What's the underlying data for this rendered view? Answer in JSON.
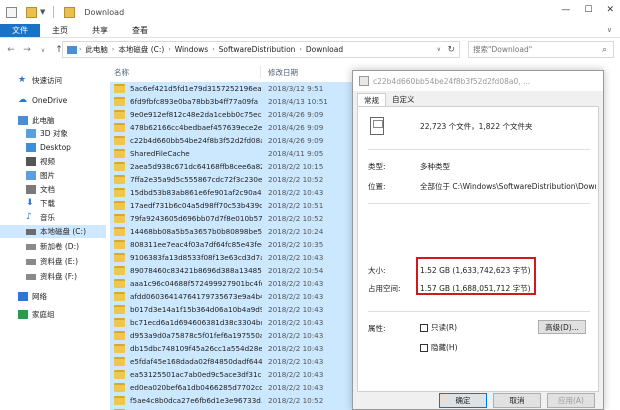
{
  "window": {
    "title": "Download",
    "controls": [
      "—",
      "☐",
      "✕"
    ]
  },
  "ribbon": {
    "tabs": [
      "文件",
      "主页",
      "共享",
      "查看"
    ]
  },
  "address": {
    "crumbs": [
      "此电脑",
      "本地磁盘 (C:)",
      "Windows",
      "SoftwareDistribution",
      "Download"
    ],
    "search_placeholder": "搜索\"Download\""
  },
  "navpane": {
    "items": [
      {
        "label": "快速访问",
        "icon": "star-icon",
        "color": "#2b78d0"
      },
      {
        "label": "OneDrive",
        "icon": "cloud-icon",
        "color": "#2b78d0"
      },
      {
        "label": "此电脑",
        "icon": "computer-icon",
        "color": "#4a8fd6"
      },
      {
        "label": "3D 对象",
        "icon": "cube-icon",
        "color": "#5aa0e0"
      },
      {
        "label": "Desktop",
        "icon": "desktop-icon",
        "color": "#3d8fd9"
      },
      {
        "label": "视频",
        "icon": "video-icon",
        "color": "#555555"
      },
      {
        "label": "图片",
        "icon": "picture-icon",
        "color": "#5aa0e0"
      },
      {
        "label": "文档",
        "icon": "document-icon",
        "color": "#7a7a7a"
      },
      {
        "label": "下载",
        "icon": "download-icon",
        "color": "#2b78d0"
      },
      {
        "label": "音乐",
        "icon": "music-icon",
        "color": "#2b78d0"
      },
      {
        "label": "本地磁盘 (C:)",
        "icon": "drive-icon",
        "color": "#6b6b6b"
      },
      {
        "label": "新加卷 (D:)",
        "icon": "drive-icon",
        "color": "#8a8a8a"
      },
      {
        "label": "资料盘 (E:)",
        "icon": "drive-icon",
        "color": "#8a8a8a"
      },
      {
        "label": "资料盘 (F:)",
        "icon": "drive-icon",
        "color": "#8a8a8a"
      },
      {
        "label": "网络",
        "icon": "network-icon",
        "color": "#2b78d0"
      },
      {
        "label": "家庭组",
        "icon": "homegroup-icon",
        "color": "#2b9a4a"
      }
    ]
  },
  "filelist": {
    "columns": {
      "name": "名称",
      "date": "修改日期"
    },
    "rows": [
      {
        "name": "5ac6ef421d5fd1e79d3157252196ea32",
        "date": "2018/3/12 9:51",
        "selected": true
      },
      {
        "name": "6fd9fbfc893e0ba78bb3b4ff77a09fa",
        "date": "2018/4/13 10:51",
        "selected": true
      },
      {
        "name": "9e0e912ef812c48e2da1cebb0c75ec0d",
        "date": "2018/4/26 9:09",
        "selected": true
      },
      {
        "name": "478b62166cc4bedbaef457639ece2e3b",
        "date": "2018/4/26 9:09",
        "selected": true
      },
      {
        "name": "c22b4d660bb54be24f8b3f52d2fd08a0",
        "date": "2018/4/26 9:09",
        "selected": true
      },
      {
        "name": "SharedFileCache",
        "date": "2018/4/11 9:05",
        "selected": true
      },
      {
        "name": "2aea5d938c671dc64168ffb8cee6a82...",
        "date": "2018/2/2 10:15",
        "selected": true
      },
      {
        "name": "7ffa2e35a9d5c555867cdc72f3c230e0...",
        "date": "2018/2/2 10:52",
        "selected": true
      },
      {
        "name": "15dbd53b83ab861e6fe901af2c90a49...",
        "date": "2018/2/2 10:43",
        "selected": true
      },
      {
        "name": "17aedf731b6c04a5d98ff70c53b439cd...",
        "date": "2018/2/2 10:51",
        "selected": true
      },
      {
        "name": "79fa9243605d696bb07d7f8e010b574...",
        "date": "2018/2/2 10:52",
        "selected": true
      },
      {
        "name": "14468bb08a5b5a3657b0b80898be52...",
        "date": "2018/2/2 10:24",
        "selected": true
      },
      {
        "name": "808311ee7eac4f03a7df64fc85e43fed...",
        "date": "2018/2/2 10:35",
        "selected": true
      },
      {
        "name": "9106383fa13d8533f08f13e63cd3d7aa...",
        "date": "2018/2/2 10:43",
        "selected": true
      },
      {
        "name": "89078460c83421b8696d388a134854...",
        "date": "2018/2/2 10:54",
        "selected": true
      },
      {
        "name": "aaa1c96c04688f572499927901bc4fd6...",
        "date": "2018/2/2 10:43",
        "selected": true
      },
      {
        "name": "afdd06036414764179735673e9a4b4...",
        "date": "2018/2/2 10:43",
        "selected": true
      },
      {
        "name": "b017d3e14a1f15b364d06a10b4a9d9...",
        "date": "2018/2/2 10:43",
        "selected": true
      },
      {
        "name": "bc71ecd6a1d694606381d38c3304bc...",
        "date": "2018/2/2 10:43",
        "selected": true
      },
      {
        "name": "d953a9d0a75878c5f01fef6a197550a9...",
        "date": "2018/2/2 10:43",
        "selected": true
      },
      {
        "name": "db15dbc748109f45a26cc1a554d28e5...",
        "date": "2018/2/2 10:43",
        "selected": true
      },
      {
        "name": "e5fdaf45e168dada02f84850dadf6444...",
        "date": "2018/2/2 10:43",
        "selected": true
      },
      {
        "name": "ea53125501ac7ab0ed9c5ace3df31cd...",
        "date": "2018/2/2 10:43",
        "selected": true
      },
      {
        "name": "ed0ea020bef6a1db0466285d7702cd...",
        "date": "2018/2/2 10:43",
        "selected": true
      },
      {
        "name": "f5ae4c8b0dca27e6fb6d1e3e96733d...",
        "date": "2018/2/2 10:52",
        "selected": true
      },
      {
        "name": "f8af5780119476bb4f5d37afc54bc9d...",
        "date": "2018/2/2 10:52",
        "selected": true
      }
    ]
  },
  "dialog": {
    "title": "c22b4d660bb54be24f8b3f52d2fd08a0, ...",
    "tabs": [
      "常规",
      "自定义"
    ],
    "summary": "22,723 个文件，1,822 个文件夹",
    "type_label": "类型:",
    "type_value": "多种类型",
    "location_label": "位置:",
    "location_value": "全部位于 C:\\Windows\\SoftwareDistribution\\Download",
    "size_label": "大小:",
    "size_value": "1.52 GB (1,633,742,623 字节)",
    "disk_label": "占用空间:",
    "disk_value": "1.57 GB (1,688,051,712 字节)",
    "attr_label": "属性:",
    "readonly_label": "只读(R)",
    "hidden_label": "隐藏(H)",
    "advanced_label": "高级(D)...",
    "ok_label": "确定",
    "cancel_label": "取消",
    "apply_label": "应用(A)"
  },
  "colors": {
    "accent": "#1a72c4",
    "selection": "#cce8ff",
    "highlight_box": "#d0191b",
    "folder": "#efc74f"
  }
}
